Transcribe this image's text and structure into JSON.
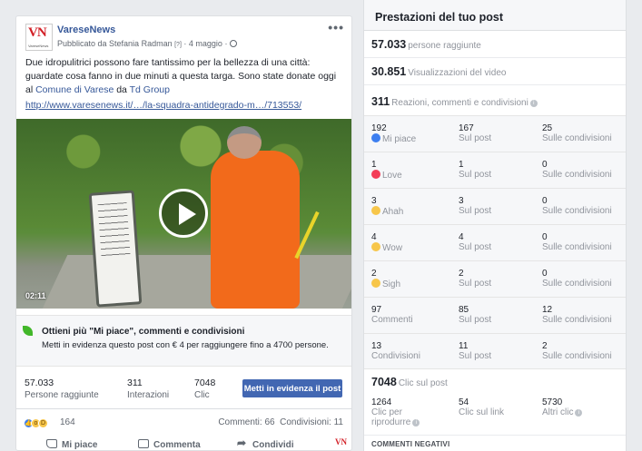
{
  "post": {
    "page_name": "VareseNews",
    "logo_text": "VN",
    "logo_sub": "VareseNews",
    "byline": "Pubblicato da Stefania Radman",
    "byline_badge": "[?]",
    "date": "4 maggio",
    "text_main": "Due idropulitrici possono fare tantissimo per la bellezza di una città: guardate cosa fanno in due minuti a questa targa. Sono state donate oggi al ",
    "text_link1": "Comune di Varese",
    "text_mid": " da ",
    "text_link2": "Td Group",
    "url": "http://www.varesenews.it/…/la-squadra-antidegrado-m…/713553/",
    "video_time": "02:11",
    "tip_title": "Ottieni più \"Mi piace\", commenti e condivisioni",
    "tip_text": "Metti in evidenza questo post con € 4 per raggiungere fino a 4700 persone.",
    "stats": [
      {
        "value": "57.033",
        "label": "Persone raggiunte"
      },
      {
        "value": "311",
        "label": "Interazioni"
      },
      {
        "value": "7048",
        "label": "Clic"
      }
    ],
    "boost_label": "Metti in evidenza il post",
    "reaction_count": "164",
    "comments": "Commenti: 66",
    "shares": "Condivisioni: 11",
    "actions": {
      "like": "Mi piace",
      "comment": "Commenta",
      "share": "Condividi"
    }
  },
  "panel": {
    "title": "Prestazioni del tuo post",
    "reach": {
      "value": "57.033",
      "label": "persone raggiunte"
    },
    "views": {
      "value": "30.851",
      "label": "Visualizzazioni del video"
    },
    "engagement": {
      "value": "311",
      "label": "Reazioni, commenti e condivisioni"
    },
    "rows": [
      {
        "total": "192",
        "label": "Mi piace",
        "icon": "like",
        "on_post": "167",
        "on_shares": "25"
      },
      {
        "total": "1",
        "label": "Love",
        "icon": "love",
        "on_post": "1",
        "on_shares": "0"
      },
      {
        "total": "3",
        "label": "Ahah",
        "icon": "haha",
        "on_post": "3",
        "on_shares": "0"
      },
      {
        "total": "4",
        "label": "Wow",
        "icon": "wow",
        "on_post": "4",
        "on_shares": "0"
      },
      {
        "total": "2",
        "label": "Sigh",
        "icon": "sad",
        "on_post": "2",
        "on_shares": "0"
      },
      {
        "total": "97",
        "label": "Commenti",
        "icon": "",
        "on_post": "85",
        "on_shares": "12"
      },
      {
        "total": "13",
        "label": "Condivisioni",
        "icon": "",
        "on_post": "11",
        "on_shares": "2"
      }
    ],
    "col_post": "Sul post",
    "col_shares": "Sulle condivisioni",
    "clicks": {
      "value": "7048",
      "label": "Clic sul post"
    },
    "click_items": [
      {
        "value": "1264",
        "label": "Clic per riprodurre"
      },
      {
        "value": "54",
        "label": "Clic sul link"
      },
      {
        "value": "5730",
        "label": "Altri clic"
      }
    ],
    "negative": "COMMENTI NEGATIVI"
  }
}
